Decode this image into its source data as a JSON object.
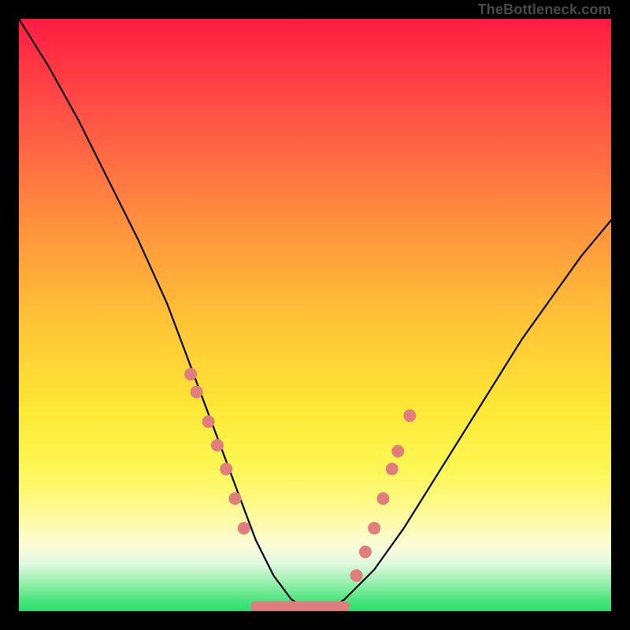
{
  "watermark": "TheBottleneck.com",
  "colors": {
    "marker": "#e27d7d",
    "curve": "#000000"
  },
  "chart_data": {
    "type": "line",
    "title": "",
    "xlabel": "",
    "ylabel": "",
    "xlim": [
      0,
      100
    ],
    "ylim": [
      0,
      100
    ],
    "series": [
      {
        "name": "bottleneck-curve",
        "x": [
          0,
          5,
          10,
          15,
          20,
          25,
          28,
          31,
          34,
          37,
          40,
          43,
          46,
          49,
          52,
          55,
          60,
          65,
          70,
          75,
          80,
          85,
          90,
          95,
          100
        ],
        "y": [
          100,
          92,
          83,
          73,
          63,
          52,
          44,
          36,
          28,
          20,
          12,
          6,
          2,
          0,
          0,
          2,
          7,
          14,
          22,
          30,
          38,
          46,
          53,
          60,
          66
        ]
      }
    ],
    "markers": {
      "left": [
        {
          "x": 29,
          "y": 40
        },
        {
          "x": 30,
          "y": 37
        },
        {
          "x": 32,
          "y": 32
        },
        {
          "x": 33.5,
          "y": 28
        },
        {
          "x": 35,
          "y": 24
        },
        {
          "x": 36.5,
          "y": 19
        },
        {
          "x": 38,
          "y": 14
        }
      ],
      "right": [
        {
          "x": 57,
          "y": 6
        },
        {
          "x": 58.5,
          "y": 10
        },
        {
          "x": 60,
          "y": 14
        },
        {
          "x": 61.5,
          "y": 19
        },
        {
          "x": 63,
          "y": 24
        },
        {
          "x": 64,
          "y": 27
        },
        {
          "x": 66,
          "y": 33
        }
      ],
      "bottom_segment": {
        "x0": 40,
        "x1": 55,
        "y": 0.8
      }
    }
  }
}
